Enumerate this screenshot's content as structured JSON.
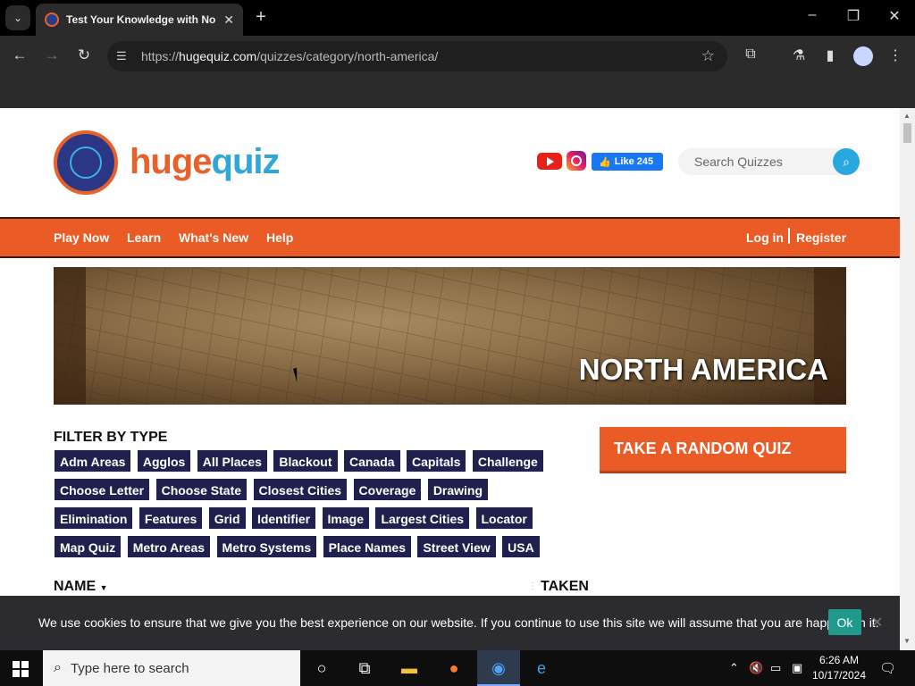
{
  "browser": {
    "tab_title": "Test Your Knowledge with North America Quizzes",
    "url_prefix": "https://",
    "url_host": "hugequiz.com",
    "url_path": "/quizzes/category/north-america/"
  },
  "site": {
    "logo_huge": "huge",
    "logo_quiz": "quiz",
    "fb_like_label": "Like 245",
    "search_placeholder": "Search Quizzes"
  },
  "nav": {
    "items": [
      "Play Now",
      "Learn",
      "What's New",
      "Help"
    ],
    "login": "Log in",
    "register": "Register"
  },
  "banner": {
    "title": "NORTH AMERICA"
  },
  "filter": {
    "title": "FILTER BY TYPE",
    "tags": [
      "Adm Areas",
      "Agglos",
      "All Places",
      "Blackout",
      "Canada",
      "Capitals",
      "Challenge",
      "Choose Letter",
      "Choose State",
      "Closest Cities",
      "Coverage",
      "Drawing",
      "Elimination",
      "Features",
      "Grid",
      "Identifier",
      "Image",
      "Largest Cities",
      "Locator",
      "Map Quiz",
      "Metro Areas",
      "Metro Systems",
      "Place Names",
      "Street View",
      "USA"
    ]
  },
  "random_quiz": {
    "label": "TAKE A RANDOM QUIZ"
  },
  "table": {
    "col_name": "NAME",
    "col_taken": "TAKEN"
  },
  "cookie": {
    "text": "We use cookies to ensure that we give you the best experience on our website. If you continue to use this site we will assume that you are happy with it.",
    "ok": "Ok"
  },
  "taskbar": {
    "search_placeholder": "Type here to search",
    "time": "6:26 AM",
    "date": "10/17/2024"
  },
  "colors": {
    "accent_orange": "#ea5b25",
    "tag_navy": "#20204e",
    "brand_blue": "#2fa7d8"
  }
}
